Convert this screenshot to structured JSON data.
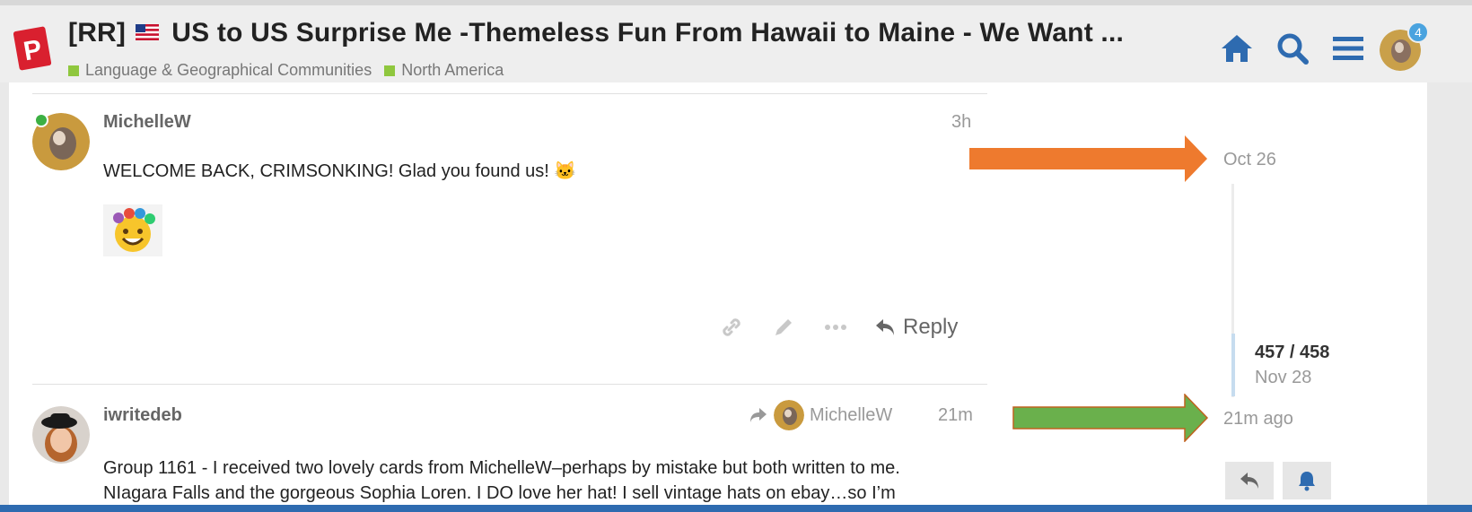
{
  "header": {
    "title": "[RR]",
    "title_rest": "US to US Surprise Me -Themeless Fun From Hawaii to Maine - We Want ...",
    "categories": [
      "Language & Geographical Communities",
      "North America"
    ],
    "notification_count": "4",
    "icons": [
      "home-icon",
      "search-icon",
      "menu-icon"
    ]
  },
  "posts": [
    {
      "username": "MichelleW",
      "time": "3h",
      "text": "WELCOME BACK, CRIMSONKING! Glad you found us! 🐱"
    },
    {
      "username": "iwritedeb",
      "time": "21m",
      "reply_to": "MichelleW",
      "text_line1": "Group 1161 - I received two lovely cards from MichelleW–perhaps by mistake but both written to me.",
      "text_line2": "NIagara Falls and the gorgeous Sophia Loren. I DO love her hat! I sell vintage hats on ebay…so I’m"
    }
  ],
  "post_actions": {
    "reply_label": "Reply"
  },
  "timeline": {
    "top_date": "Oct 26",
    "position": "457 / 458",
    "position_date": "Nov 28",
    "bottom_date": "21m ago"
  },
  "colors": {
    "accent_blue": "#2e6bb0",
    "category_green": "#8fc73e",
    "orange_arrow": "#ee7a2e",
    "green_arrow": "#6ab04c"
  }
}
